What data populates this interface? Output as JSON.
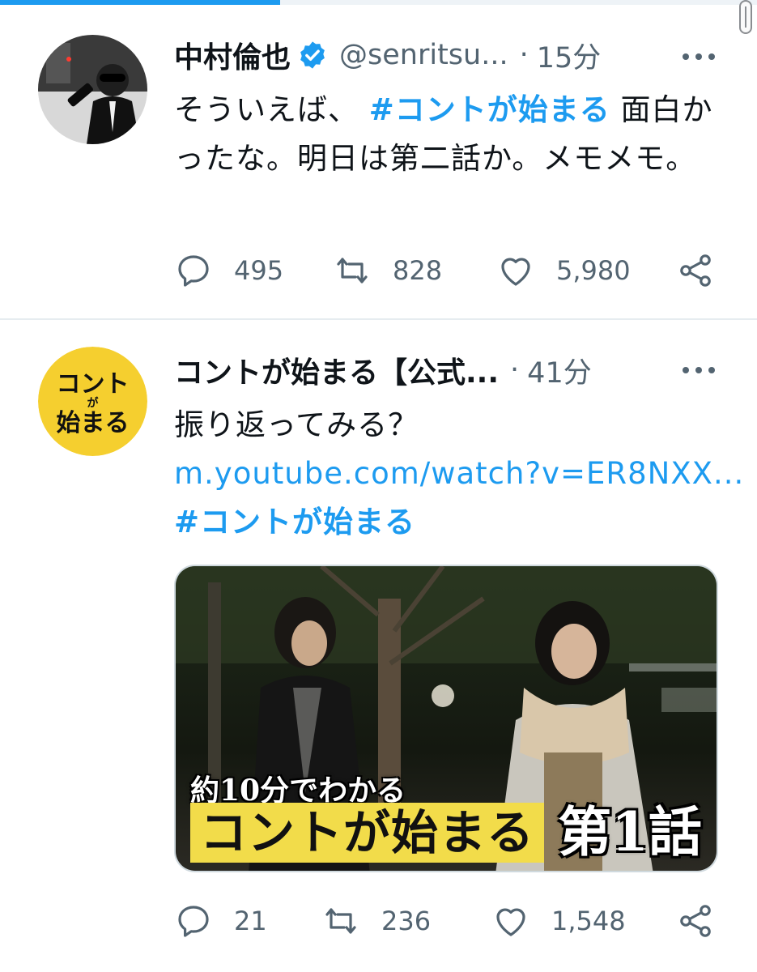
{
  "scroll_progress_percent": 37,
  "colors": {
    "accent": "#1d9bf0",
    "secondary_text": "#536471",
    "avatar_yellow": "#f5cf2f"
  },
  "tweets": [
    {
      "display_name": "中村倫也",
      "verified": true,
      "handle": "@senritsu...",
      "separator": "·",
      "time": "15分",
      "avatar_icon": "person-photo-avatar",
      "text_segments": [
        {
          "text": "そういえば、 ",
          "kind": "plain"
        },
        {
          "text": "#コントが始まる",
          "kind": "hashtag"
        },
        {
          "text": " 面白かったな。明日は第二話か。メモメモ。",
          "kind": "plain"
        }
      ],
      "replies": "495",
      "retweets": "828",
      "likes": "5,980"
    },
    {
      "display_name": "コントが始まる【公式...",
      "verified": false,
      "separator": "·",
      "time": "41分",
      "avatar_text_top": "コント",
      "avatar_text_mid": "が",
      "avatar_text_bottom": "始まる",
      "text": "振り返ってみる？",
      "link": "m.youtube.com/watch?v=ER8NXX...",
      "hashtag": "#コントが始まる",
      "media": {
        "caption": "約10分でわかる",
        "title": "コントが始まる",
        "episode": "第1話"
      },
      "replies": "21",
      "retweets": "236",
      "likes": "1,548"
    }
  ]
}
